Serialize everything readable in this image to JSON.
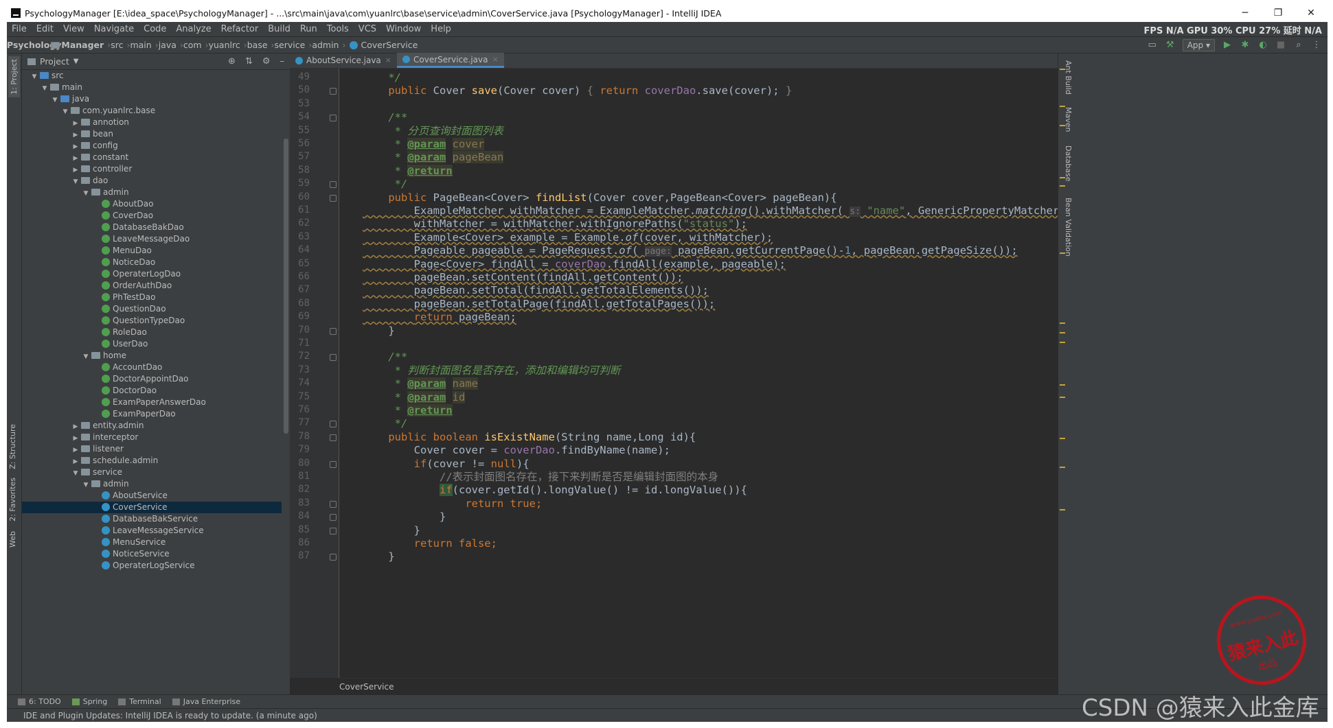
{
  "window": {
    "title": "PsychologyManager [E:\\idea_space\\PsychologyManager] - ...\\src\\main\\java\\com\\yuanlrc\\base\\service\\admin\\CoverService.java [PsychologyManager] - IntelliJ IDEA",
    "minimize": "─",
    "restore": "❐",
    "close": "✕"
  },
  "menu": [
    "File",
    "Edit",
    "View",
    "Navigate",
    "Code",
    "Analyze",
    "Refactor",
    "Build",
    "Run",
    "Tools",
    "VCS",
    "Window",
    "Help"
  ],
  "perf": "FPS N/A GPU 30% CPU 27% 延时 N/A",
  "breadcrumbs": [
    "PsychologyManager",
    "src",
    "main",
    "java",
    "com",
    "yuanlrc",
    "base",
    "service",
    "admin",
    "CoverService"
  ],
  "run_config": "App",
  "left_tabs": [
    "1: Project",
    "Z: Structure",
    "2: Favorites",
    "Web"
  ],
  "project_panel": {
    "title": "Project",
    "tree": [
      {
        "label": "src",
        "depth": 0,
        "kind": "src",
        "open": true
      },
      {
        "label": "main",
        "depth": 1,
        "kind": "folder",
        "open": true
      },
      {
        "label": "java",
        "depth": 2,
        "kind": "src",
        "open": true
      },
      {
        "label": "com.yuanlrc.base",
        "depth": 3,
        "kind": "folder",
        "open": true
      },
      {
        "label": "annotion",
        "depth": 4,
        "kind": "folder",
        "open": false
      },
      {
        "label": "bean",
        "depth": 4,
        "kind": "folder",
        "open": false
      },
      {
        "label": "config",
        "depth": 4,
        "kind": "folder",
        "open": false
      },
      {
        "label": "constant",
        "depth": 4,
        "kind": "folder",
        "open": false
      },
      {
        "label": "controller",
        "depth": 4,
        "kind": "folder",
        "open": false
      },
      {
        "label": "dao",
        "depth": 4,
        "kind": "folder",
        "open": true
      },
      {
        "label": "admin",
        "depth": 5,
        "kind": "folder",
        "open": true
      },
      {
        "label": "AboutDao",
        "depth": 6,
        "kind": "iface"
      },
      {
        "label": "CoverDao",
        "depth": 6,
        "kind": "iface"
      },
      {
        "label": "DatabaseBakDao",
        "depth": 6,
        "kind": "iface"
      },
      {
        "label": "LeaveMessageDao",
        "depth": 6,
        "kind": "iface"
      },
      {
        "label": "MenuDao",
        "depth": 6,
        "kind": "iface"
      },
      {
        "label": "NoticeDao",
        "depth": 6,
        "kind": "iface"
      },
      {
        "label": "OperaterLogDao",
        "depth": 6,
        "kind": "iface"
      },
      {
        "label": "OrderAuthDao",
        "depth": 6,
        "kind": "iface"
      },
      {
        "label": "PhTestDao",
        "depth": 6,
        "kind": "iface"
      },
      {
        "label": "QuestionDao",
        "depth": 6,
        "kind": "iface"
      },
      {
        "label": "QuestionTypeDao",
        "depth": 6,
        "kind": "iface"
      },
      {
        "label": "RoleDao",
        "depth": 6,
        "kind": "iface"
      },
      {
        "label": "UserDao",
        "depth": 6,
        "kind": "iface"
      },
      {
        "label": "home",
        "depth": 5,
        "kind": "folder",
        "open": true
      },
      {
        "label": "AccountDao",
        "depth": 6,
        "kind": "iface"
      },
      {
        "label": "DoctorAppointDao",
        "depth": 6,
        "kind": "iface"
      },
      {
        "label": "DoctorDao",
        "depth": 6,
        "kind": "iface"
      },
      {
        "label": "ExamPaperAnswerDao",
        "depth": 6,
        "kind": "iface"
      },
      {
        "label": "ExamPaperDao",
        "depth": 6,
        "kind": "iface"
      },
      {
        "label": "entity.admin",
        "depth": 4,
        "kind": "folder",
        "open": false
      },
      {
        "label": "interceptor",
        "depth": 4,
        "kind": "folder",
        "open": false
      },
      {
        "label": "listener",
        "depth": 4,
        "kind": "folder",
        "open": false
      },
      {
        "label": "schedule.admin",
        "depth": 4,
        "kind": "folder",
        "open": false
      },
      {
        "label": "service",
        "depth": 4,
        "kind": "folder",
        "open": true
      },
      {
        "label": "admin",
        "depth": 5,
        "kind": "folder",
        "open": true
      },
      {
        "label": "AboutService",
        "depth": 6,
        "kind": "class"
      },
      {
        "label": "CoverService",
        "depth": 6,
        "kind": "class",
        "selected": true
      },
      {
        "label": "DatabaseBakService",
        "depth": 6,
        "kind": "class"
      },
      {
        "label": "LeaveMessageService",
        "depth": 6,
        "kind": "class"
      },
      {
        "label": "MenuService",
        "depth": 6,
        "kind": "class"
      },
      {
        "label": "NoticeService",
        "depth": 6,
        "kind": "class"
      },
      {
        "label": "OperaterLogService",
        "depth": 6,
        "kind": "class"
      }
    ]
  },
  "tabs": [
    {
      "label": "AboutService.java",
      "active": false
    },
    {
      "label": "CoverService.java",
      "active": true
    }
  ],
  "editor": {
    "first_line": 49,
    "line_numbers": [
      49,
      50,
      53,
      54,
      55,
      56,
      57,
      58,
      59,
      60,
      61,
      62,
      63,
      64,
      65,
      66,
      67,
      68,
      69,
      70,
      71,
      72,
      73,
      74,
      75,
      76,
      77,
      78,
      79,
      80,
      81,
      82,
      83,
      84,
      85,
      86,
      87
    ],
    "breadcrumb": "CoverService",
    "code_lines": [
      [
        [
          "    ",
          "p"
        ],
        [
          "*/",
          "cm"
        ]
      ],
      [
        [
          "    ",
          "p"
        ],
        [
          "public ",
          "kw"
        ],
        [
          "Cover ",
          "p"
        ],
        [
          "save",
          "fn"
        ],
        [
          "(Cover cover) ",
          "p"
        ],
        [
          "{ ",
          "gcm"
        ],
        [
          "return ",
          "kw"
        ],
        [
          "coverDao",
          "fld"
        ],
        [
          ".save(cover); ",
          "p"
        ],
        [
          "}",
          "gcm"
        ]
      ],
      [
        [
          "",
          "p"
        ]
      ],
      [
        [
          "    ",
          "p"
        ],
        [
          "/**",
          "cm"
        ]
      ],
      [
        [
          "     * 分页查询封面图列表",
          "cm"
        ]
      ],
      [
        [
          "     * ",
          "cm"
        ],
        [
          "@param",
          "tg"
        ],
        [
          " ",
          "cm"
        ],
        [
          "cover",
          "pv"
        ]
      ],
      [
        [
          "     * ",
          "cm"
        ],
        [
          "@param",
          "tg"
        ],
        [
          " ",
          "cm"
        ],
        [
          "pageBean",
          "pv"
        ]
      ],
      [
        [
          "     * ",
          "cm"
        ],
        [
          "@return",
          "tg"
        ]
      ],
      [
        [
          "     */",
          "cm"
        ]
      ],
      [
        [
          "    ",
          "p"
        ],
        [
          "public ",
          "kw"
        ],
        [
          "PageBean<Cover> ",
          "p"
        ],
        [
          "findList",
          "fn"
        ],
        [
          "(Cover cover,PageBean<Cover> pageBean){",
          "p"
        ]
      ],
      [
        [
          "        ExampleMatcher withMatcher = ExampleMatcher.",
          "p"
        ],
        [
          "matching",
          "it"
        ],
        [
          "().withMatcher( ",
          "p"
        ],
        [
          "s:",
          "hint"
        ],
        [
          " ",
          "p"
        ],
        [
          "\"name\"",
          "str"
        ],
        [
          ", GenericPropertyMatchers.",
          "p"
        ],
        [
          "contains",
          "it"
        ],
        [
          "());",
          "p"
        ]
      ],
      [
        [
          "        withMatcher = withMatcher.withIgnorePaths(",
          "p"
        ],
        [
          "\"status\"",
          "str"
        ],
        [
          ");",
          "p"
        ]
      ],
      [
        [
          "        Example<Cover> example = Example.",
          "p"
        ],
        [
          "of",
          "it"
        ],
        [
          "(cover, withMatcher);",
          "p"
        ]
      ],
      [
        [
          "        Pageable pageable = PageRequest.",
          "p"
        ],
        [
          "of",
          "it"
        ],
        [
          "( ",
          "p"
        ],
        [
          "page:",
          "hint"
        ],
        [
          " pageBean.getCurrentPage()-",
          "p"
        ],
        [
          "1",
          "num"
        ],
        [
          ", pageBean.getPageSize());",
          "p"
        ]
      ],
      [
        [
          "        Page<Cover> findAll = ",
          "p"
        ],
        [
          "coverDao",
          "fld"
        ],
        [
          ".findAll(example, pageable);",
          "p"
        ]
      ],
      [
        [
          "        pageBean.setContent(findAll.getContent());",
          "p"
        ]
      ],
      [
        [
          "        pageBean.setTotal(findAll.getTotalElements());",
          "p"
        ]
      ],
      [
        [
          "        pageBean.setTotalPage(findAll.getTotalPages());",
          "p"
        ]
      ],
      [
        [
          "        ",
          "p"
        ],
        [
          "return ",
          "kw"
        ],
        [
          "pageBean;",
          "p"
        ]
      ],
      [
        [
          "    }",
          "p"
        ]
      ],
      [
        [
          "",
          "p"
        ]
      ],
      [
        [
          "    ",
          "p"
        ],
        [
          "/**",
          "cm"
        ]
      ],
      [
        [
          "     * 判断封面图名是否存在，添加和编辑均可判断",
          "cm"
        ]
      ],
      [
        [
          "     * ",
          "cm"
        ],
        [
          "@param",
          "tg"
        ],
        [
          " ",
          "cm"
        ],
        [
          "name",
          "pv"
        ]
      ],
      [
        [
          "     * ",
          "cm"
        ],
        [
          "@param",
          "tg"
        ],
        [
          " ",
          "cm"
        ],
        [
          "id",
          "pv"
        ]
      ],
      [
        [
          "     * ",
          "cm"
        ],
        [
          "@return",
          "tg"
        ]
      ],
      [
        [
          "     */",
          "cm"
        ]
      ],
      [
        [
          "    ",
          "p"
        ],
        [
          "public ",
          "kw"
        ],
        [
          "boolean ",
          "kw"
        ],
        [
          "isExistName",
          "fn"
        ],
        [
          "(String name,Long id){",
          "p"
        ]
      ],
      [
        [
          "        Cover cover = ",
          "p"
        ],
        [
          "coverDao",
          "fld"
        ],
        [
          ".findByName(name);",
          "p"
        ]
      ],
      [
        [
          "        ",
          "p"
        ],
        [
          "if",
          "kw"
        ],
        [
          "(cover != ",
          "p"
        ],
        [
          "null",
          "kw"
        ],
        [
          "){",
          "p"
        ]
      ],
      [
        [
          "            ",
          "p"
        ],
        [
          "//表示封面图名存在，接下来判断是否是编辑封面图的本身",
          "gcm"
        ]
      ],
      [
        [
          "            ",
          "p"
        ],
        [
          "if",
          "kwh"
        ],
        [
          "(cover.getId().longValue() != id.longValue()){",
          "p"
        ]
      ],
      [
        [
          "                ",
          "p"
        ],
        [
          "return ",
          "kw"
        ],
        [
          "true",
          "kw"
        ],
        [
          ";",
          "kw"
        ]
      ],
      [
        [
          "            }",
          "p"
        ]
      ],
      [
        [
          "        }",
          "p"
        ]
      ],
      [
        [
          "        ",
          "p"
        ],
        [
          "return ",
          "kw"
        ],
        [
          "false",
          "kw"
        ],
        [
          ";",
          "kw"
        ]
      ],
      [
        [
          "    }",
          "p"
        ]
      ]
    ]
  },
  "right_tabs": [
    "Ant Build",
    "Maven",
    "Database",
    "Bean Validation"
  ],
  "bottom_tools": [
    "6: TODO",
    "Spring",
    "Terminal",
    "Java Enterprise"
  ],
  "status": "IDE and Plugin Updates: IntelliJ IDEA is ready to update. (a minute ago)",
  "stamp": {
    "url": "www.yuanrc.com",
    "name": "猿来入此",
    "sub": "出品"
  },
  "watermark": "CSDN @猿来入此金库"
}
